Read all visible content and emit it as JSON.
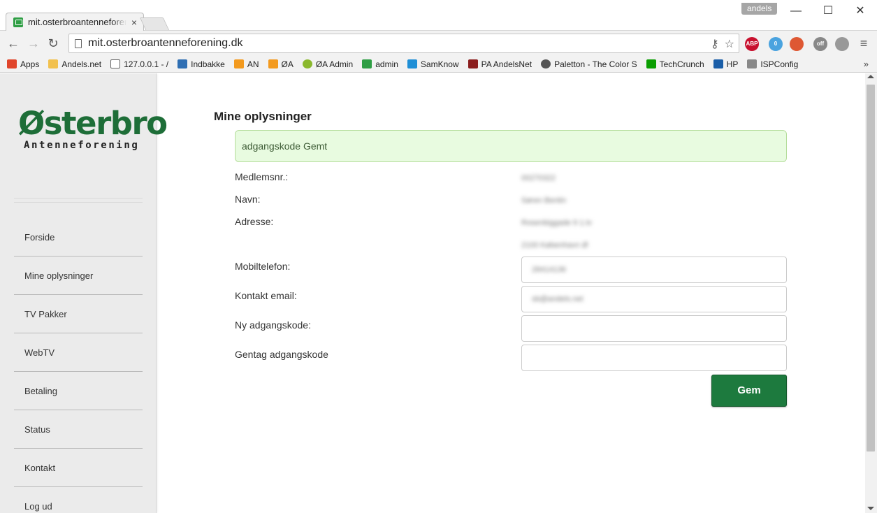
{
  "browser": {
    "tab_title": "mit.osterbroantenneforening.dk",
    "tab_close": "×",
    "profile_name": "andels",
    "url": "mit.osterbroantenneforening.dk",
    "window_minimize": "—",
    "window_maximize": "☐",
    "window_close": "✕",
    "back": "←",
    "forward": "→",
    "reload": "↻",
    "bookmark_more": "»",
    "bookmarks": [
      {
        "label": "Apps",
        "icon": "apps-grid-icon",
        "color": "#e0452b"
      },
      {
        "label": "Andels.net",
        "icon": "folder-icon",
        "color": "#f2c14e"
      },
      {
        "label": "127.0.0.1 - /",
        "icon": "page-icon",
        "color": "#ffffff"
      },
      {
        "label": "Indbakke",
        "icon": "inbox-icon",
        "color": "#2f6fb3"
      },
      {
        "label": "AN",
        "icon": "pma-icon",
        "color": "#f39a1e"
      },
      {
        "label": "ØA",
        "icon": "pma-icon",
        "color": "#f39a1e"
      },
      {
        "label": "ØA Admin",
        "icon": "admin-icon",
        "color": "#8ab82d"
      },
      {
        "label": "admin",
        "icon": "site-icon",
        "color": "#2e9e44"
      },
      {
        "label": "SamKnow",
        "icon": "samknow-icon",
        "color": "#1f8fd6"
      },
      {
        "label": "PA AndelsNet",
        "icon": "pa-icon",
        "color": "#8b1d1d"
      },
      {
        "label": "Paletton - The Color S",
        "icon": "paletton-icon",
        "color": "#555555"
      },
      {
        "label": "TechCrunch",
        "icon": "techcrunch-icon",
        "color": "#0a9e01"
      },
      {
        "label": "HP",
        "icon": "hp-icon",
        "color": "#1a5ea8"
      },
      {
        "label": "ISPConfig",
        "icon": "tools-icon",
        "color": "#888888"
      }
    ],
    "extensions": [
      {
        "name": "abp-icon",
        "label": "ABP",
        "color": "#c8102e"
      },
      {
        "name": "ghostery-icon",
        "label": "0",
        "color": "#4aa3df"
      },
      {
        "name": "duckduckgo-icon",
        "label": "",
        "color": "#de5833"
      },
      {
        "name": "extension-off-icon",
        "label": "off",
        "color": "#888888"
      },
      {
        "name": "settings-extension-icon",
        "label": "",
        "color": "#999999"
      }
    ]
  },
  "brand": {
    "name": "Østerbro",
    "tagline": "Antenneforening",
    "color": "#1e6e38"
  },
  "nav": [
    {
      "label": "Forside"
    },
    {
      "label": "Mine oplysninger"
    },
    {
      "label": "TV Pakker"
    },
    {
      "label": "WebTV"
    },
    {
      "label": "Betaling"
    },
    {
      "label": "Status"
    },
    {
      "label": "Kontakt"
    },
    {
      "label": "Log ud"
    }
  ],
  "page": {
    "heading": "Mine oplysninger",
    "alert": "adgangskode Gemt",
    "member_label": "Medlemsnr.:",
    "member_value": "00270322",
    "name_label": "Navn:",
    "name_value": "Søren Bentin",
    "address_label": "Adresse:",
    "address_line1": "Rosenbiggade 9 1.tv",
    "address_line2": "2100 København Ø",
    "mobile_label": "Mobiltelefon:",
    "mobile_value": "28414136",
    "email_label": "Kontakt email:",
    "email_value": "sb@andels.net",
    "newpw_label": "Ny adgangskode:",
    "newpw_value": "",
    "repeatpw_label": "Gentag adgangskode",
    "repeatpw_value": "",
    "save_label": "Gem"
  }
}
